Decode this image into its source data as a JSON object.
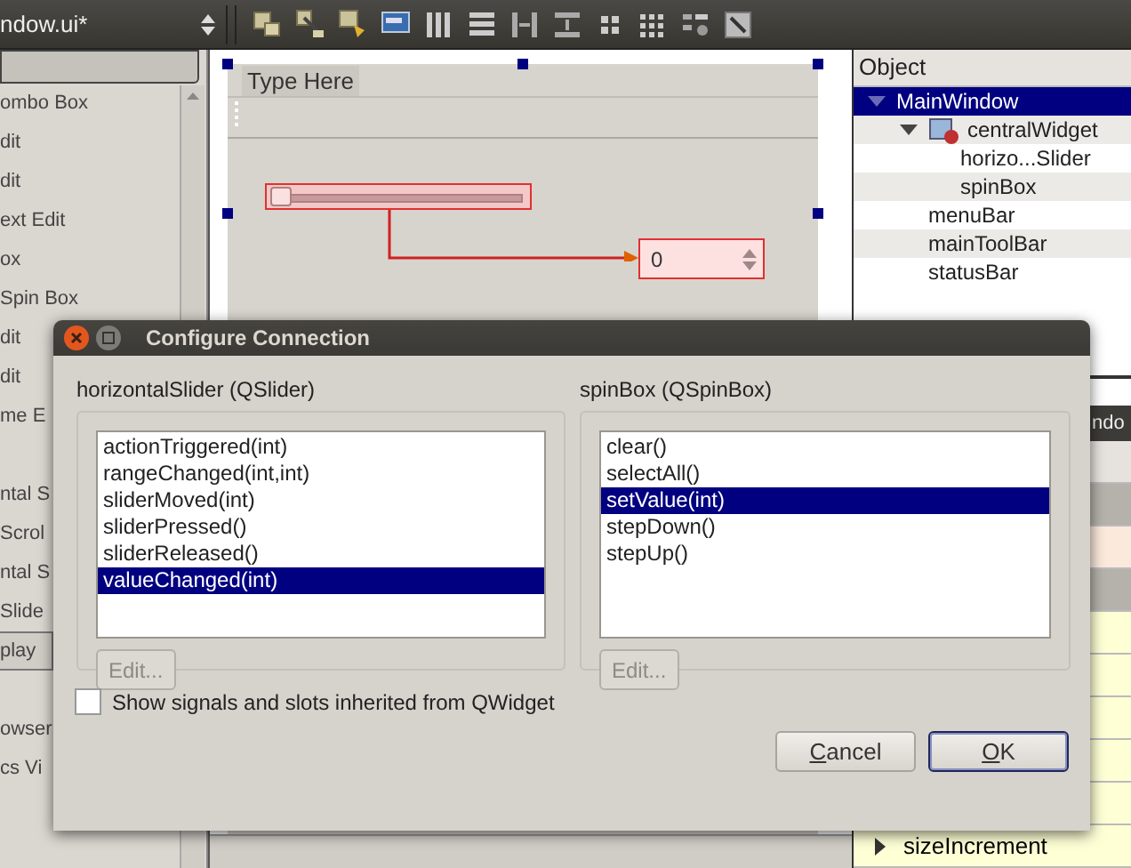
{
  "top_bar": {
    "file_combo": "ndow.ui*"
  },
  "widget_box": {
    "items": [
      {
        "label": "ombo Box",
        "kind": "item"
      },
      {
        "label": "dit",
        "kind": "item"
      },
      {
        "label": "dit",
        "kind": "item"
      },
      {
        "label": "ext Edit",
        "kind": "item"
      },
      {
        "label": "ox",
        "kind": "item"
      },
      {
        "label": "Spin Box",
        "kind": "item"
      },
      {
        "label": "dit",
        "kind": "item"
      },
      {
        "label": "dit",
        "kind": "item"
      },
      {
        "label": "me E",
        "kind": "item"
      },
      {
        "kind": "blank"
      },
      {
        "label": "ntal S",
        "kind": "item"
      },
      {
        "label": "Scrol",
        "kind": "item"
      },
      {
        "label": "ntal S",
        "kind": "item"
      },
      {
        "label": "Slide",
        "kind": "item"
      },
      {
        "label": "play",
        "kind": "category"
      },
      {
        "kind": "blank"
      },
      {
        "label": "owser",
        "kind": "item"
      },
      {
        "label": "cs Vi",
        "kind": "item"
      }
    ]
  },
  "form": {
    "menu_placeholder": "Type Here",
    "slider": {
      "level": 0
    },
    "spinbox": {
      "value": "0"
    }
  },
  "object_inspector": {
    "header": "Object",
    "tree": [
      {
        "name": "MainWindow",
        "selected": true,
        "expanded": true,
        "children": [
          {
            "name": "centralWidget",
            "selected": false,
            "expanded": true,
            "children": [
              {
                "name": "horizo...Slider",
                "selected": false
              },
              {
                "name": "spinBox",
                "selected": false
              }
            ]
          },
          {
            "name": "menuBar",
            "selected": false
          },
          {
            "name": "mainToolBar",
            "selected": false
          },
          {
            "name": "statusBar",
            "selected": false
          }
        ]
      }
    ]
  },
  "property_editor": {
    "title": "ndo",
    "rows": [
      {
        "kind": "columns"
      },
      {
        "kind": "group"
      },
      {
        "kind": "changed"
      },
      {
        "kind": "group"
      },
      {
        "kind": "property"
      },
      {
        "kind": "property"
      },
      {
        "kind": "property"
      },
      {
        "kind": "property"
      },
      {
        "kind": "property"
      },
      {
        "kind": "expandable",
        "name": "sizeIncrement"
      }
    ]
  },
  "dialog": {
    "title": "Configure Connection",
    "signals": {
      "label": "horizontalSlider (QSlider)",
      "items": [
        {
          "label": "actionTriggered(int)",
          "selected": false
        },
        {
          "label": "rangeChanged(int,int)",
          "selected": false
        },
        {
          "label": "sliderMoved(int)",
          "selected": false
        },
        {
          "label": "sliderPressed()",
          "selected": false
        },
        {
          "label": "sliderReleased()",
          "selected": false
        },
        {
          "label": "valueChanged(int)",
          "selected": true
        }
      ],
      "edit_button": {
        "label": "Edit...",
        "disabled": true
      }
    },
    "slots": {
      "label": "spinBox (QSpinBox)",
      "items": [
        {
          "label": "clear()",
          "selected": false
        },
        {
          "label": "selectAll()",
          "selected": false
        },
        {
          "label": "setValue(int)",
          "selected": true
        },
        {
          "label": "stepDown()",
          "selected": false
        },
        {
          "label": "stepUp()",
          "selected": false
        }
      ],
      "edit_button": {
        "label": "Edit...",
        "disabled": true
      }
    },
    "inherited": {
      "label": "Show signals and slots inherited from QWidget",
      "checked": false
    },
    "buttons": [
      {
        "label": "Cancel",
        "default": false
      },
      {
        "label": "OK",
        "default": true
      }
    ]
  }
}
